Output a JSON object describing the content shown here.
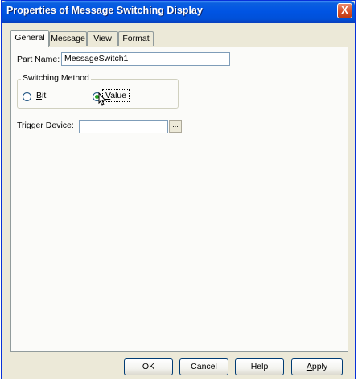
{
  "window": {
    "title": "Properties of Message Switching Display",
    "close_glyph": "X"
  },
  "tabs": [
    {
      "label": "General",
      "active": true
    },
    {
      "label": "Message",
      "active": false
    },
    {
      "label": "View",
      "active": false
    },
    {
      "label": "Format",
      "active": false
    }
  ],
  "general": {
    "part_name_label": "art Name:",
    "part_name_mnemonic": "P",
    "part_name_value": "MessageSwitch1",
    "switching_method_title": "Switching Method",
    "radio_bit_label": "it",
    "radio_bit_mnemonic": "B",
    "radio_value_label": "alue",
    "radio_value_mnemonic": "V",
    "selected_method": "Value",
    "trigger_device_label": "rigger Device:",
    "trigger_device_mnemonic": "T",
    "trigger_device_value": "",
    "browse_label": "..."
  },
  "buttons": {
    "ok": "OK",
    "cancel": "Cancel",
    "help": "Help",
    "apply_rest": "pply",
    "apply_mnemonic": "A"
  },
  "colors": {
    "title_bar": "#0054e3",
    "dialog_face": "#ece9d8",
    "close_button": "#d9532c",
    "radio_selected": "#21a121"
  }
}
